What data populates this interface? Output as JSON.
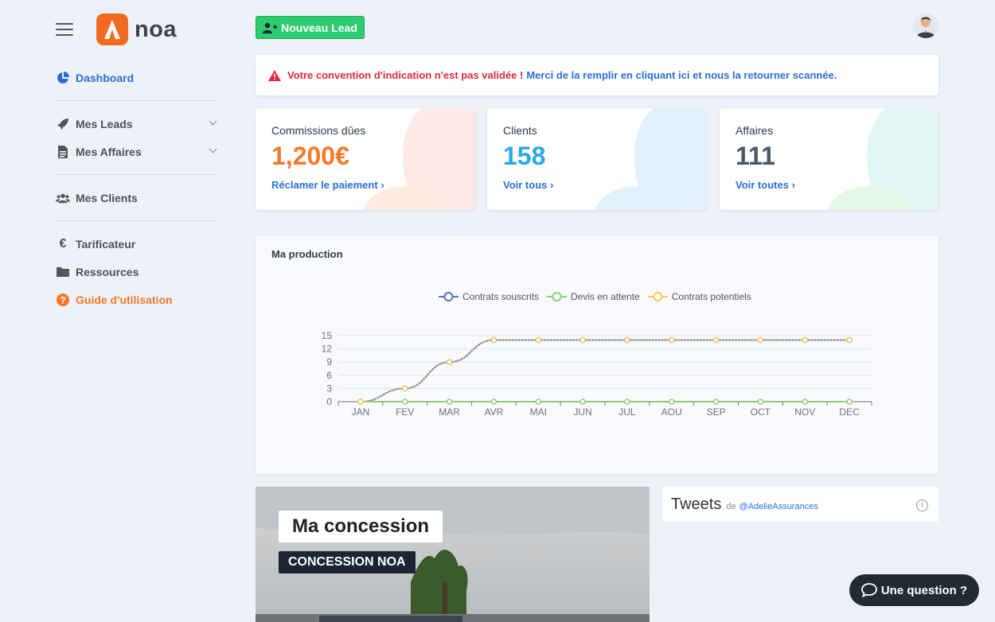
{
  "brand": {
    "name": "noa"
  },
  "sidebar": {
    "items": [
      {
        "label": "Dashboard",
        "icon": "pie-chart-icon"
      },
      {
        "label": "Mes Leads",
        "icon": "rocket-icon"
      },
      {
        "label": "Mes Affaires",
        "icon": "document-icon"
      },
      {
        "label": "Mes Clients",
        "icon": "users-icon"
      },
      {
        "label": "Tarificateur",
        "icon": "euro-icon"
      },
      {
        "label": "Ressources",
        "icon": "folder-icon"
      },
      {
        "label": "Guide d'utilisation",
        "icon": "question-circle-icon"
      }
    ]
  },
  "header": {
    "new_lead_label": "Nouveau Lead"
  },
  "alert": {
    "warning_text": "Votre convention d'indication n'est pas validée !",
    "link_text": "Merci de la remplir en cliquant ici et nous la retourner scannée."
  },
  "cards": [
    {
      "title": "Commissions dûes",
      "value": "1,200€",
      "link": "Réclamer le paiement",
      "color": "#f27a28"
    },
    {
      "title": "Clients",
      "value": "158",
      "link": "Voir tous",
      "color": "#2aa8ea"
    },
    {
      "title": "Affaires",
      "value": "111",
      "link": "Voir toutes",
      "color": "#4a5868"
    }
  ],
  "production": {
    "title": "Ma production"
  },
  "chart_data": {
    "type": "line",
    "categories": [
      "JAN",
      "FEV",
      "MAR",
      "AVR",
      "MAI",
      "JUN",
      "JUL",
      "AOU",
      "SEP",
      "OCT",
      "NOV",
      "DEC"
    ],
    "series": [
      {
        "name": "Contrats souscrits",
        "color": "#5470c6",
        "values": [
          0,
          3,
          9,
          14,
          14,
          14,
          14,
          14,
          14,
          14,
          14,
          14
        ]
      },
      {
        "name": "Devis en attente",
        "color": "#91cc75",
        "values": [
          0,
          0,
          0,
          0,
          0,
          0,
          0,
          0,
          0,
          0,
          0,
          0
        ]
      },
      {
        "name": "Contrats potentiels",
        "color": "#fac858",
        "values": [
          0,
          3,
          9,
          14,
          14,
          14,
          14,
          14,
          14,
          14,
          14,
          14
        ]
      }
    ],
    "yticks": [
      0,
      3,
      6,
      9,
      12,
      15
    ],
    "ylim": [
      0,
      15
    ],
    "grid": true,
    "legend": "top-center"
  },
  "concession": {
    "title": "Ma concession",
    "badge": "CONCESSION NOA"
  },
  "tweets": {
    "title": "Tweets",
    "de": "de",
    "handle": "@AdelieAssurances",
    "info": "i"
  },
  "help": {
    "label": "Une question ?"
  }
}
